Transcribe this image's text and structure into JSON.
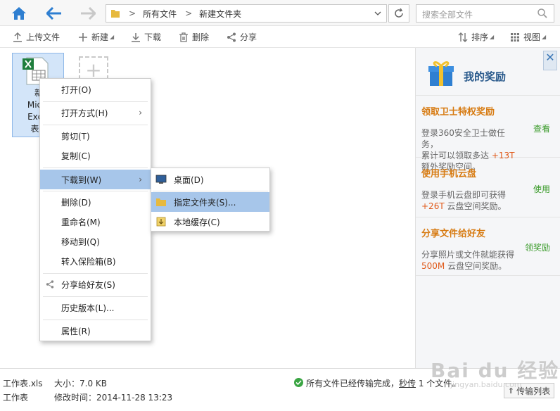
{
  "address": {
    "crumbs": [
      "所有文件",
      "新建文件夹"
    ]
  },
  "search": {
    "placeholder": "搜索全部文件"
  },
  "toolbar": {
    "upload": "上传文件",
    "new": "新建",
    "download": "下载",
    "delete": "删除",
    "share": "分享",
    "sort": "排序",
    "view": "视图"
  },
  "file": {
    "name_lines": [
      "新",
      "Micro",
      "Excel",
      "表.x"
    ]
  },
  "context_menu": {
    "items": [
      {
        "label": "打开(O)"
      },
      {
        "label": "打开方式(H)"
      },
      {
        "label": "剪切(T)"
      },
      {
        "label": "复制(C)"
      },
      {
        "label": "下载到(W)"
      },
      {
        "label": "删除(D)"
      },
      {
        "label": "重命名(M)"
      },
      {
        "label": "移动到(Q)"
      },
      {
        "label": "转入保险箱(B)"
      },
      {
        "label": "分享给好友(S)"
      },
      {
        "label": "历史版本(L)..."
      },
      {
        "label": "属性(R)"
      }
    ]
  },
  "submenu": {
    "items": [
      {
        "label": "桌面(D)"
      },
      {
        "label": "指定文件夹(S)..."
      },
      {
        "label": "本地缓存(C)"
      }
    ]
  },
  "rewards": {
    "title": "我的奖励",
    "items": [
      {
        "title": "领取卫士特权奖励",
        "desc1": "登录360安全卫士做任务，",
        "desc2": "累计可以领取多达",
        "highlight": "+13T",
        "desc3": "额外奖励空间。",
        "action": "查看"
      },
      {
        "title": "使用手机云盘",
        "desc1": "登录手机云盘即可获得",
        "highlight": "+26T",
        "desc2": "云盘空间奖励。",
        "action": "使用"
      },
      {
        "title": "分享文件给好友",
        "desc1": "分享照片或文件就能获得",
        "highlight": "500M",
        "desc2": "云盘空间奖励。",
        "action": "领奖励"
      }
    ]
  },
  "status": {
    "filename": "工作表.xls",
    "filename2": "工作表",
    "size": "大小：7.0 KB",
    "modified": "修改时间：2014-11-28 13:23",
    "message": "所有文件已经传输完成，",
    "link": "秒传",
    "count": "1 个文件。",
    "transfer_btn": "传输列表"
  },
  "watermark": {
    "text": "Bai du 经验",
    "sub": "jingyan.baidu.com"
  },
  "colors": {
    "selection": "#a7c6ea",
    "accent_blue": "#2f7fd1",
    "reward_orange": "#d77b12",
    "action_green": "#3a9b2a"
  }
}
